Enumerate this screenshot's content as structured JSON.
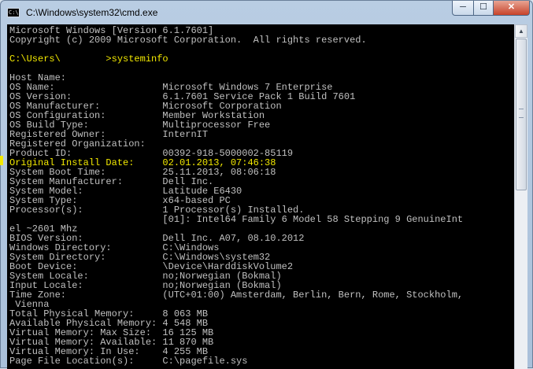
{
  "window": {
    "title": "C:\\Windows\\system32\\cmd.exe",
    "controls": {
      "minimize": "─",
      "maximize": "☐",
      "close": "✕"
    }
  },
  "console": {
    "lines": [
      "Microsoft Windows [Version 6.1.7601]",
      "Copyright (c) 2009 Microsoft Corporation.  All rights reserved.",
      "",
      "C:\\Users\\        >systeminfo",
      "",
      "Host Name:",
      "OS Name:                   Microsoft Windows 7 Enterprise",
      "OS Version:                6.1.7601 Service Pack 1 Build 7601",
      "OS Manufacturer:           Microsoft Corporation",
      "OS Configuration:          Member Workstation",
      "OS Build Type:             Multiprocessor Free",
      "Registered Owner:          InternIT",
      "Registered Organization:",
      "Product ID:                00392-918-5000002-85119",
      "Original Install Date:     02.01.2013, 07:46:38",
      "System Boot Time:          25.11.2013, 08:06:18",
      "System Manufacturer:       Dell Inc.",
      "System Model:              Latitude E6430",
      "System Type:               x64-based PC",
      "Processor(s):              1 Processor(s) Installed.",
      "                           [01]: Intel64 Family 6 Model 58 Stepping 9 GenuineInt",
      "el ~2601 Mhz",
      "BIOS Version:              Dell Inc. A07, 08.10.2012",
      "Windows Directory:         C:\\Windows",
      "System Directory:          C:\\Windows\\system32",
      "Boot Device:               \\Device\\HarddiskVolume2",
      "System Locale:             no;Norwegian (Bokmal)",
      "Input Locale:              no;Norwegian (Bokmal)",
      "Time Zone:                 (UTC+01:00) Amsterdam, Berlin, Bern, Rome, Stockholm,",
      " Vienna",
      "Total Physical Memory:     8 063 MB",
      "Available Physical Memory: 4 548 MB",
      "Virtual Memory: Max Size:  16 125 MB",
      "Virtual Memory: Available: 11 870 MB",
      "Virtual Memory: In Use:    4 255 MB",
      "Page File Location(s):     C:\\pagefile.sys"
    ]
  },
  "colors": {
    "console_text": "#c0c0c0",
    "console_bg": "#000000",
    "highlight": "#f2e800"
  },
  "scrollbar": {
    "up_arrow": "▲"
  }
}
